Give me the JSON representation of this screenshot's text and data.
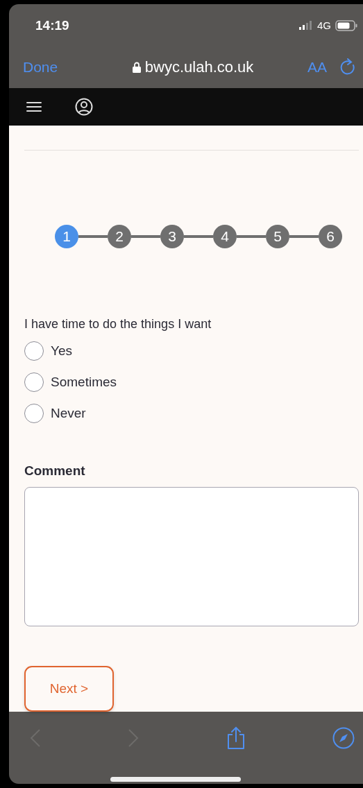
{
  "status_bar": {
    "time": "14:19",
    "network": "4G"
  },
  "browser": {
    "done": "Done",
    "url": "bwyc.ulah.co.uk",
    "text_size": "AA"
  },
  "steps": [
    {
      "label": "1",
      "selected": true
    },
    {
      "label": "2",
      "selected": false
    },
    {
      "label": "3",
      "selected": false
    },
    {
      "label": "4",
      "selected": false
    },
    {
      "label": "5",
      "selected": false
    },
    {
      "label": "6",
      "selected": false
    }
  ],
  "question": "I have time to do the things I want",
  "options": [
    {
      "label": "Yes",
      "selected": false
    },
    {
      "label": "Sometimes",
      "selected": false
    },
    {
      "label": "Never",
      "selected": false
    }
  ],
  "comment": {
    "label": "Comment"
  },
  "next_button": "Next >",
  "toolbar": {
    "back_disabled": true,
    "forward_disabled": true
  }
}
